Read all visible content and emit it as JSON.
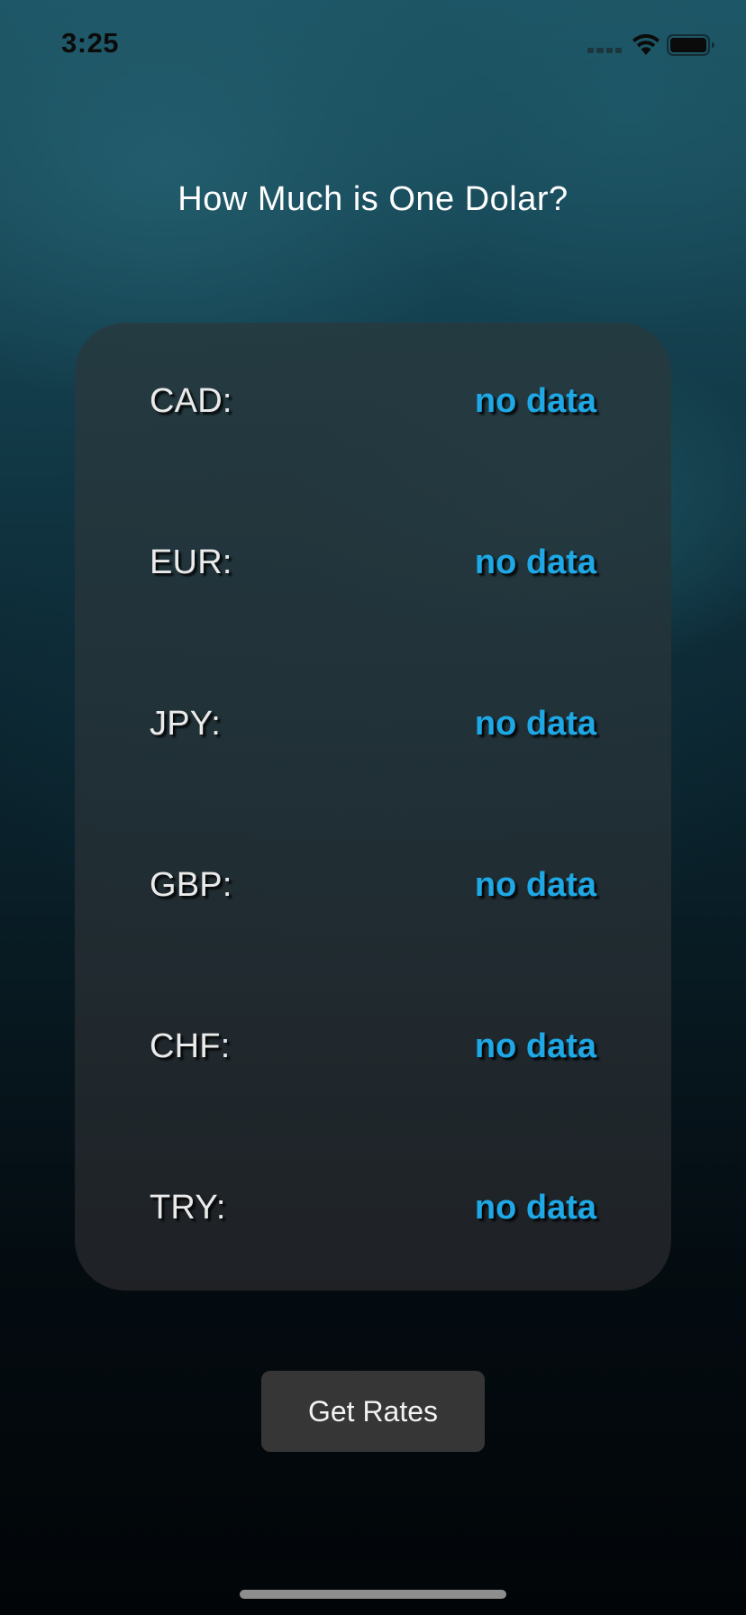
{
  "status_bar": {
    "time": "3:25"
  },
  "header": {
    "title": "How Much is One Dolar?"
  },
  "rates": [
    {
      "code": "CAD:",
      "value": "no data"
    },
    {
      "code": "EUR:",
      "value": "no data"
    },
    {
      "code": "JPY:",
      "value": "no data"
    },
    {
      "code": "GBP:",
      "value": "no data"
    },
    {
      "code": "CHF:",
      "value": "no data"
    },
    {
      "code": "TRY:",
      "value": "no data"
    }
  ],
  "actions": {
    "get_rates_label": "Get Rates"
  },
  "colors": {
    "accent_value": "#1fa8e6",
    "button_bg": "#363636"
  }
}
